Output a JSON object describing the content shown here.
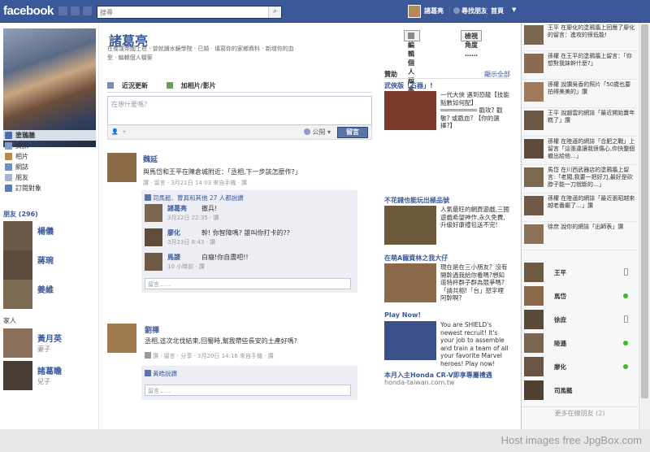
{
  "topbar": {
    "logo": "facebook",
    "search_placeholder": "搜尋",
    "user_name": "諸葛亮",
    "find_friends": "尋找朋友",
    "home": "首頁"
  },
  "profile": {
    "name": "諸葛亮",
    "info_line1": "在蜀漢帝國上班 · 曾就讀水鏡學院 · 已婚 · 填寫你的家鄉資料 · 新增你的血",
    "info_line2": "型 · 編輯個人檔案",
    "edit_button": "編輯個人檔案",
    "view_as_button": "檢視角度 ……"
  },
  "left_nav": [
    {
      "label": "塗鴉牆",
      "color": "#4a6ea9"
    },
    {
      "label": "資訊",
      "color": "#7f9fc9"
    },
    {
      "label": "相片",
      "color": "#b58a50"
    },
    {
      "label": "網誌",
      "color": "#6c8fbd"
    },
    {
      "label": "朋友",
      "color": "#a7b4c9"
    },
    {
      "label": "訂閱對象",
      "color": "#5d7db1"
    }
  ],
  "friends_label": "朋友 (296)",
  "friends": [
    {
      "name": "楊儀"
    },
    {
      "name": "蔣琬"
    },
    {
      "name": "姜維"
    }
  ],
  "family_label": "家人",
  "family": [
    {
      "name": "黃月英",
      "relation": "妻子"
    },
    {
      "name": "諸葛瞻",
      "relation": "兒子"
    }
  ],
  "composer": {
    "tab_status": "近況更新",
    "tab_photo": "加相片/影片",
    "placeholder": "在想什麼嗎？",
    "audience": "公開",
    "post_button": "留言"
  },
  "story1": {
    "author": "魏延",
    "text": "與馬岱和王平在陳倉城附近：「丞相,下一步該怎麼作?」",
    "meta": "讚 · 留言 · 3月21日 14:03 來自手機 · 讚",
    "likes": "司馬懿、曹真和其他 27 人都說讚",
    "comments": [
      {
        "author": "諸葛亮",
        "text": "撤兵!",
        "meta": "3月22日 22:35 · 讚"
      },
      {
        "author": "廖化",
        "text": "幹! 你智障嗎? 誰叫你打卡的??",
        "meta": "3月23日 8:43 · 讚"
      },
      {
        "author": "馬謖",
        "text": "白癡!你自盡吧!!",
        "meta": "10 小時前 · 讚"
      }
    ],
    "comment_placeholder": "留言……"
  },
  "story2": {
    "author": "劉禪",
    "text": "丞相,這次北伐結束,回蜀時,幫我帶些長安的土產好嗎?",
    "meta": "讚 · 留言 · 分享 · 3月20日 14:16 來自手機 · 讚",
    "likes": "黃皓說讚",
    "comment_placeholder": "留言……"
  },
  "ads": {
    "header": "贊助",
    "see_all": "顯示全部",
    "items": [
      {
        "title": "武俠版「石器」!",
        "text": "一代大俠 遇到恐龍【技能點數如何配】══════════ 戳攻? 戳敏? 或戳血? 【你的選擇?】",
        "color": "#7b3a2a"
      },
      {
        "title": "不花錢也能玩出極品號",
        "text": "人氣最旺的網頁遊戲,三國遊戲希望神作,永久免費,升級好康禮包送不完!",
        "color": "#6c5a3a"
      },
      {
        "title": "在萌A寵資林之我大仔",
        "text": "現在是在三小朋友？沒有開幹過我給你看嗎?想知道特杯群子群為競爭嗎?「請共相!「台」怒字哩阿幹啊?",
        "color": "#8a6a4a"
      },
      {
        "title": "Play Now!",
        "text": "You are SHIELD's newest recruit! It's your job to assemble and train a team of all your favorite Marvel heroes! Play now!",
        "color": "#3b4f8a"
      },
      {
        "title": "本月入主Honda CR-V即享專屬禮遇",
        "subtitle": "honda-taiwan.com.tw",
        "color": "#555"
      }
    ]
  },
  "ticker": [
    {
      "text": "王平 在廖化的塗鴉牆上回應了廖化的留言：進攻的很低能!"
    },
    {
      "text": "孫權 在王平的塗鴉牆上留言：「你想對我妹幹什麼?」"
    },
    {
      "text": "孫權 說讚吳香的照片「50歲也要拍得美美的」讚"
    },
    {
      "text": "王平 說趙雲的網誌「最近開始賣年糕了」讚"
    },
    {
      "text": "孫權 在陸遜的網誌「合肥之戰」上留言「這張違讓我很傷心,你快整個撤出給他…」"
    },
    {
      "text": "馬岱 在川西武器店的塗鴉牆上留言:「老闆,我要一把好刀,最好是砍脖子能一刀就斷的…」"
    },
    {
      "text": "孫權 在陸遜的網誌「最近張昭越來越老番癲了…」讚"
    },
    {
      "text": "徐庶 說你的網誌「出師表」讚"
    }
  ],
  "chat": {
    "buddies": [
      {
        "name": "王平",
        "status": "mobile"
      },
      {
        "name": "馬岱",
        "status": "online"
      },
      {
        "name": "徐庶",
        "status": "mobile"
      },
      {
        "name": "陸遜",
        "status": "online"
      },
      {
        "name": "廖化",
        "status": "online"
      },
      {
        "name": "司馬懿",
        "status": "none"
      }
    ],
    "more": "更多在線朋友 (2)"
  },
  "watermark": "Host images free JpgBox.com"
}
